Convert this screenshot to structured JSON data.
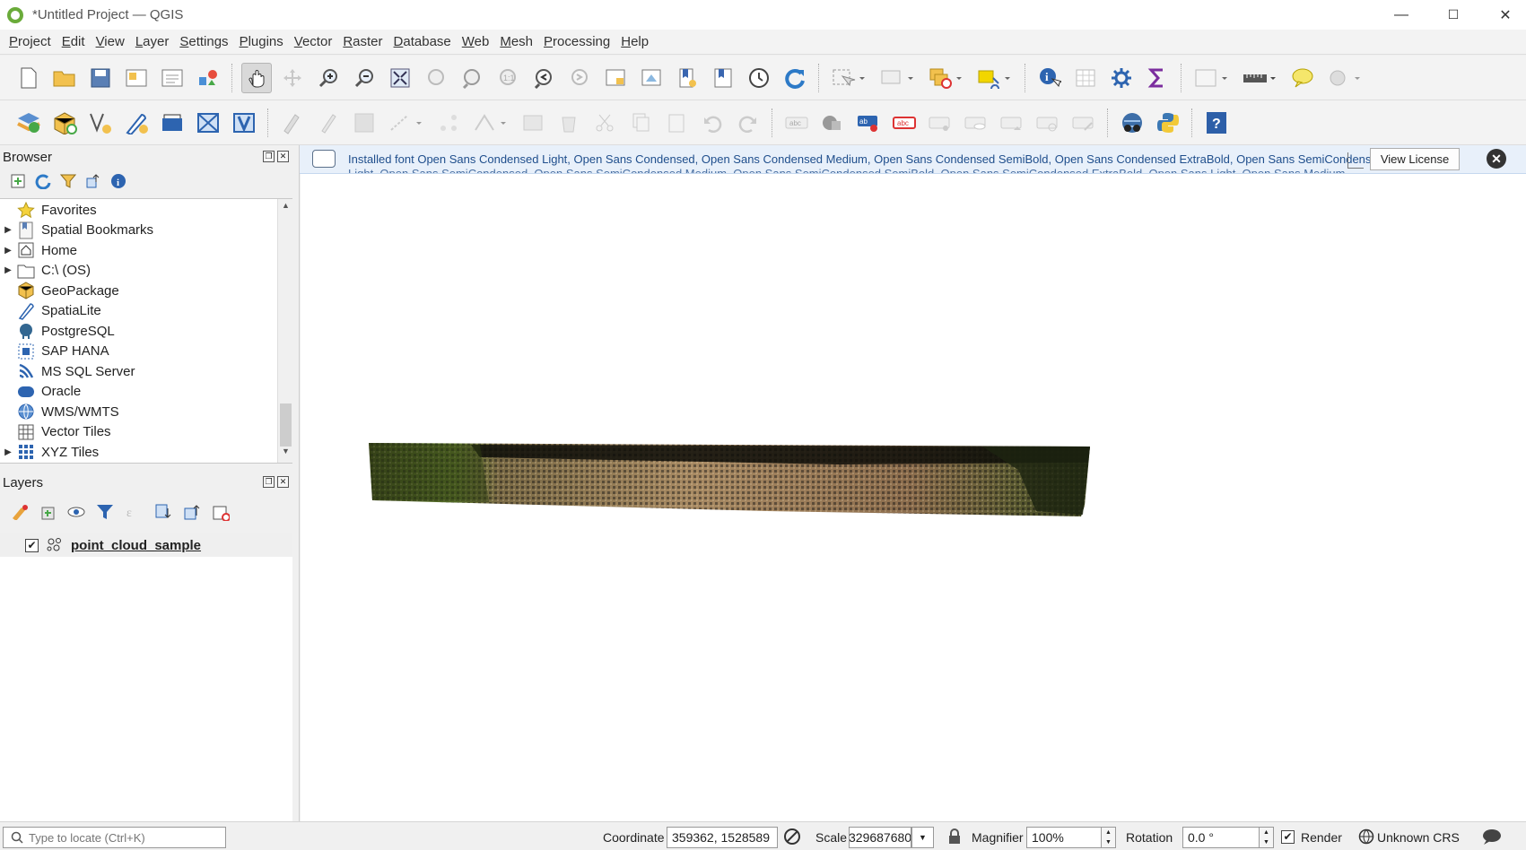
{
  "window": {
    "title": "*Untitled Project — QGIS",
    "min": "—",
    "max": "☐",
    "close": "✕"
  },
  "menu": [
    "Project",
    "Edit",
    "View",
    "Layer",
    "Settings",
    "Plugins",
    "Vector",
    "Raster",
    "Database",
    "Web",
    "Mesh",
    "Processing",
    "Help"
  ],
  "browser": {
    "title": "Browser",
    "items": [
      {
        "label": "Favorites",
        "expandable": false,
        "icon": "star-icon"
      },
      {
        "label": "Spatial Bookmarks",
        "expandable": true,
        "icon": "bookmark-icon"
      },
      {
        "label": "Home",
        "expandable": true,
        "icon": "home-folder-icon"
      },
      {
        "label": "C:\\ (OS)",
        "expandable": true,
        "icon": "drive-folder-icon"
      },
      {
        "label": "GeoPackage",
        "expandable": false,
        "icon": "geopackage-icon"
      },
      {
        "label": "SpatiaLite",
        "expandable": false,
        "icon": "spatialite-icon"
      },
      {
        "label": "PostgreSQL",
        "expandable": false,
        "icon": "postgresql-icon"
      },
      {
        "label": "SAP HANA",
        "expandable": false,
        "icon": "sap-hana-icon"
      },
      {
        "label": "MS SQL Server",
        "expandable": false,
        "icon": "mssql-icon"
      },
      {
        "label": "Oracle",
        "expandable": false,
        "icon": "oracle-icon"
      },
      {
        "label": "WMS/WMTS",
        "expandable": false,
        "icon": "wms-icon"
      },
      {
        "label": "Vector Tiles",
        "expandable": false,
        "icon": "vector-tiles-icon"
      },
      {
        "label": "XYZ Tiles",
        "expandable": true,
        "icon": "xyz-tiles-icon"
      }
    ]
  },
  "layers": {
    "title": "Layers",
    "items": [
      {
        "label": "point_cloud_sample",
        "checked": true
      }
    ]
  },
  "message": {
    "line1": "Installed font Open Sans Condensed Light, Open Sans Condensed, Open Sans Condensed Medium, Open Sans Condensed SemiBold, Open Sans Condensed ExtraBold, Open Sans SemiCondensed",
    "line2": "Light, Open Sans SemiCondensed, Open Sans SemiCondensed Medium, Open Sans SemiCondensed SemiBold, Open Sans SemiCondensed ExtraBold, Open Sans Light, Open Sans Medium",
    "license_button": "View License"
  },
  "status": {
    "locate_placeholder": "Type to locate (Ctrl+K)",
    "coordinate_label": "Coordinate",
    "coordinate_value": "359362, 1528589",
    "scale_label": "Scale",
    "scale_value": "329687680",
    "magnifier_label": "Magnifier",
    "magnifier_value": "100%",
    "rotation_label": "Rotation",
    "rotation_value": "0.0 °",
    "render_label": "Render",
    "crs_label": "Unknown CRS"
  },
  "colors": {
    "accent": "#1f4e8c",
    "message_bg": "#e8f0fa",
    "qgis_green": "#6aab3a"
  }
}
